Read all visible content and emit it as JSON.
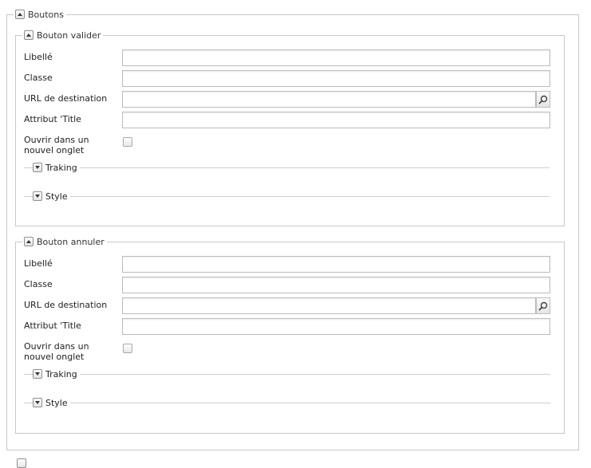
{
  "outer": {
    "title": "Boutons"
  },
  "form_labels": {
    "libelle": "Libellé",
    "classe": "Classe",
    "url": "URL de destination",
    "title_attr": "Attribut 'Title",
    "new_tab": "Ouvrir dans un nouvel onglet"
  },
  "sections": [
    {
      "title": "Bouton valider",
      "fields": {
        "libelle": "",
        "classe": "",
        "url": "",
        "title_attr": ""
      },
      "new_tab_checked": false,
      "subsections": {
        "tracking": "Traking",
        "style": "Style"
      }
    },
    {
      "title": "Bouton annuler",
      "fields": {
        "libelle": "",
        "classe": "",
        "url": "",
        "title_attr": ""
      },
      "new_tab_checked": false,
      "subsections": {
        "tracking": "Traking",
        "style": "Style"
      }
    }
  ],
  "icons": {
    "collapse": "triangle-up-icon",
    "expand": "triangle-down-icon",
    "search": "magnifier-icon"
  }
}
